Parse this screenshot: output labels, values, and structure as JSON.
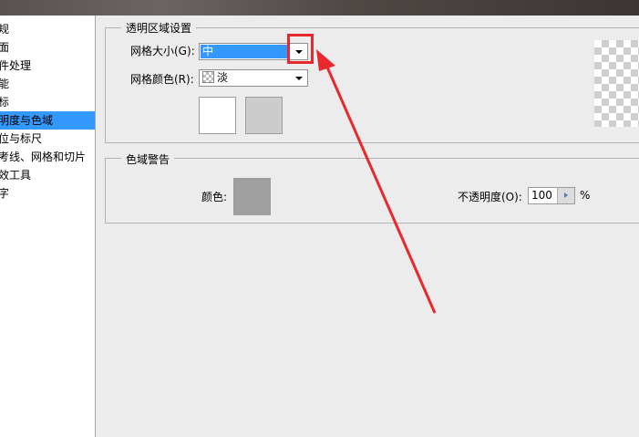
{
  "sidebar": {
    "items": [
      {
        "label": "规",
        "selected": false
      },
      {
        "label": "面",
        "selected": false
      },
      {
        "label": "件处理",
        "selected": false
      },
      {
        "label": "能",
        "selected": false
      },
      {
        "label": "标",
        "selected": false
      },
      {
        "label": "明度与色域",
        "selected": true
      },
      {
        "label": "位与标尺",
        "selected": false
      },
      {
        "label": "考线、网格和切片",
        "selected": false
      },
      {
        "label": "效工具",
        "selected": false
      },
      {
        "label": "字",
        "selected": false
      }
    ]
  },
  "transparency": {
    "title": "透明区域设置",
    "grid_size_label": "网格大小(G):",
    "grid_size_value": "中",
    "grid_color_label": "网格颜色(R):",
    "grid_color_value": "淡",
    "swatch1_color": "#ffffff",
    "swatch2_color": "#cccccc"
  },
  "gamut": {
    "title": "色域警告",
    "color_label": "颜色:",
    "color_value": "#a0a0a0",
    "opacity_label": "不透明度(O):",
    "opacity_value": "100",
    "opacity_unit": "%"
  },
  "colors": {
    "selection": "#3399ff",
    "annotation": "#e8282c"
  }
}
